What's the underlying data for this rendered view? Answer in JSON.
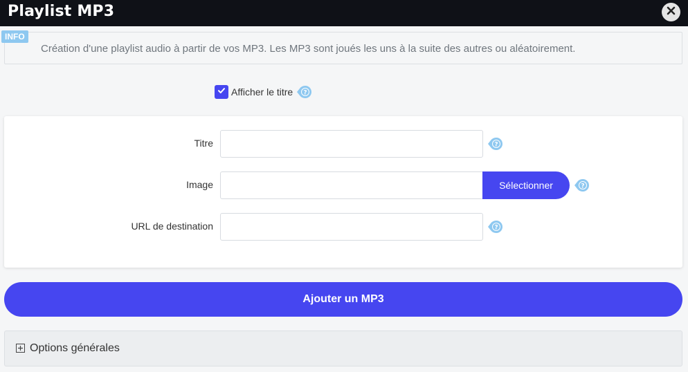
{
  "window": {
    "title": "Playlist MP3",
    "close_icon": "close-icon"
  },
  "info": {
    "badge": "INFO",
    "text": "Création d'une playlist audio à partir de vos MP3. Les MP3 sont joués les uns à la suite des autres ou aléatoirement."
  },
  "show_title": {
    "label": "Afficher le titre",
    "checked": true
  },
  "form": {
    "title_label": "Titre",
    "title_value": "",
    "image_label": "Image",
    "image_value": "",
    "select_label": "Sélectionner",
    "url_label": "URL de destination",
    "url_value": ""
  },
  "actions": {
    "add_label": "Ajouter un MP3"
  },
  "options": {
    "label": "Options générales",
    "expanded": false
  },
  "colors": {
    "accent": "#4646f0",
    "titlebar": "#0f1117",
    "info_badge": "#8ec8f0",
    "help_icon": "#8ec8f0"
  }
}
